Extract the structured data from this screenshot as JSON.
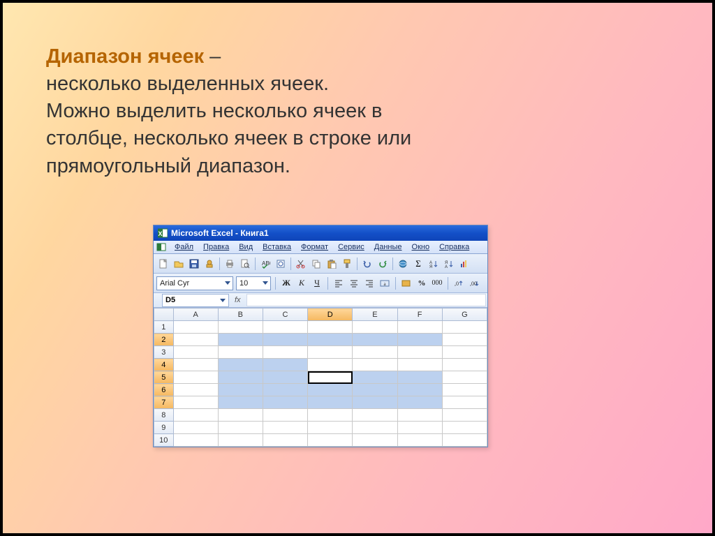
{
  "title_term": "Диапазон ячеек",
  "title_dash": " –",
  "definition_line1": "несколько выделенных ячеек.",
  "definition_line2": "Можно выделить несколько ячеек в",
  "definition_line3": "столбце, несколько ячеек в строке или",
  "definition_line4": "прямоугольный диапазон.",
  "excel": {
    "window_title": "Microsoft Excel - Книга1",
    "menus": [
      "Файл",
      "Правка",
      "Вид",
      "Вставка",
      "Формат",
      "Сервис",
      "Данные",
      "Окно",
      "Справка"
    ],
    "font_name": "Arial Cyr",
    "font_size": "10",
    "name_box": "D5",
    "columns": [
      "A",
      "B",
      "C",
      "D",
      "E",
      "F",
      "G"
    ],
    "rows": [
      "1",
      "2",
      "3",
      "4",
      "5",
      "6",
      "7",
      "8",
      "9",
      "10"
    ],
    "selected_rows": [
      2,
      4,
      5,
      6,
      7
    ],
    "active_cell": "D5",
    "selections": [
      {
        "row": 2,
        "cols": [
          "B",
          "C",
          "D",
          "E",
          "F"
        ]
      },
      {
        "row": 4,
        "cols": [
          "B",
          "C"
        ]
      },
      {
        "row": 5,
        "cols": [
          "B",
          "C",
          "E",
          "F"
        ]
      },
      {
        "row": 6,
        "cols": [
          "B",
          "C",
          "D",
          "E",
          "F"
        ]
      },
      {
        "row": 7,
        "cols": [
          "B",
          "C",
          "D",
          "E",
          "F"
        ]
      }
    ]
  }
}
